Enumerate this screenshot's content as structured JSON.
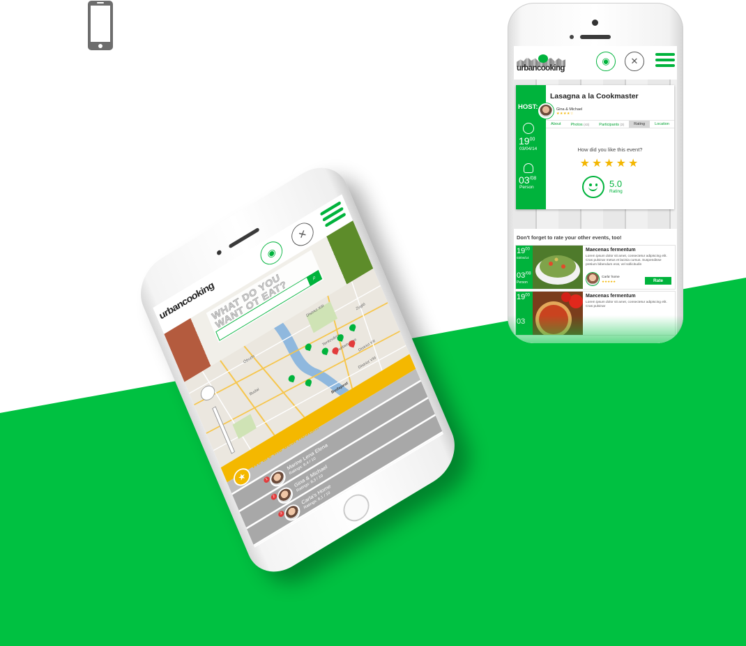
{
  "colors": {
    "brand_green": "#00b33c",
    "background_green": "#00c141",
    "accent_yellow": "#f4b800",
    "star_gold": "#f3b600"
  },
  "right_phone": {
    "header": {
      "logo_text": "urbancooking",
      "icons": [
        "cooking-event-icon",
        "cutlery-icon",
        "menu-icon"
      ]
    },
    "event": {
      "title": "Lasagna a la Cookmaster",
      "host_label": "HOST:",
      "host_name": "Gina & Michael",
      "host_stars": "★★★★☆",
      "time_hour": "19",
      "time_minutes": "00",
      "date": "03/04/14",
      "person_count": "03",
      "person_max": "08",
      "person_label": "Person",
      "tabs": [
        {
          "label": "About",
          "count": ""
        },
        {
          "label": "Photos",
          "count": "(43)"
        },
        {
          "label": "Participants",
          "count": "(3)"
        },
        {
          "label": "Rating",
          "count": ""
        },
        {
          "label": "Location",
          "count": ""
        }
      ],
      "active_tab": "Rating",
      "question": "How did you like this event?",
      "stars": "★★★★★",
      "score": "5.0",
      "score_label": "Rating"
    },
    "section_title": "Don't forget to rate your other events, too!",
    "other_events": [
      {
        "time_hour": "19",
        "time_minutes": "00",
        "date": "03/04/14",
        "person_count": "03",
        "person_max": "08",
        "person_label": "Person",
        "title": "Maecenas fermentum",
        "text": "Lorem ipsum dolor sit amet, consectetur adipiscing elit. Cras pulvinar metus et lacinia cursus. Suspendisse pretium bibendum erat, vel sollicitudin",
        "host": "Carla' home",
        "host_stars": "★★★★★",
        "button": "Rate"
      },
      {
        "time_hour": "19",
        "time_minutes": "00",
        "date": "",
        "person_count": "03",
        "person_max": "",
        "person_label": "",
        "title": "Maecenas fermentum",
        "text": "Lorem ipsum dolor sit amet, consectetur adipiscing elit. Cras pulvinar",
        "host": "",
        "host_stars": "",
        "button": ""
      }
    ]
  },
  "left_phone": {
    "header": {
      "logo_text": "urbancooking"
    },
    "hero": {
      "line1": "WHAT DO YOU",
      "line2": "WANT OT EAT?",
      "search_value": ""
    },
    "map_labels": [
      "District XIII",
      "Budapest",
      "District VII",
      "District VIII",
      "Zugló",
      "Terézváros",
      "Erzsébetváros",
      "Budai",
      "Óbuda"
    ],
    "hosts_title": "We are the best hosts...",
    "hosts": [
      {
        "rank": "1",
        "name": "Marine Lena Elena",
        "rating": "Ratings: 8,4 / 10"
      },
      {
        "rank": "2",
        "name": "Gina & Michael",
        "rating": "Ratings: 8,3 / 10"
      },
      {
        "rank": "3",
        "name": "Carla's Home",
        "rating": "Ratings: 8,1 / 10"
      }
    ]
  }
}
